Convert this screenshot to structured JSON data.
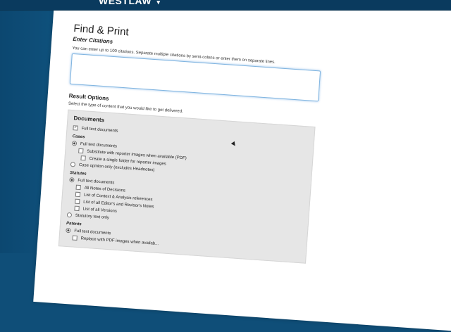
{
  "header": {
    "brand": "WESTLAW",
    "brand_caret": "▾"
  },
  "page": {
    "title": "Find & Print",
    "enter_citations_label": "Enter Citations",
    "citations_hint": "You can enter up to 100 citations. Separate multiple citations by semi-colons or enter them on separate lines.",
    "citations_value": ""
  },
  "result_options": {
    "title": "Result Options",
    "hint": "Select the type of content that you would like to get delivered.",
    "documents": {
      "title": "Documents",
      "full_text": {
        "label": "Full text documents",
        "checked": true
      }
    },
    "cases": {
      "title": "Cases",
      "full_text": {
        "label": "Full text documents",
        "selected": true
      },
      "substitute": {
        "label": "Substitute with reporter images when available (PDF)",
        "checked": false
      },
      "single_folder": {
        "label": "Create a single folder for reporter images",
        "checked": false
      },
      "opinion_only": {
        "label": "Case opinion only (excludes Headnotes)",
        "selected": false
      }
    },
    "statutes": {
      "title": "Statutes",
      "full_text": {
        "label": "Full text documents",
        "selected": true
      },
      "notes": {
        "label": "All Notes of Decisions",
        "checked": false
      },
      "context": {
        "label": "List of Context & Analysis references",
        "checked": false
      },
      "editors": {
        "label": "List of all Editor's and Revisor's Notes",
        "checked": false
      },
      "versions": {
        "label": "List of all Versions",
        "checked": false
      },
      "statutory_only": {
        "label": "Statutory text only",
        "selected": false
      }
    },
    "patents": {
      "title": "Patents",
      "full_text": {
        "label": "Full text documents",
        "selected": true
      },
      "replace_pdf": {
        "label": "Replace with PDF images when availab...",
        "checked": false
      }
    }
  }
}
